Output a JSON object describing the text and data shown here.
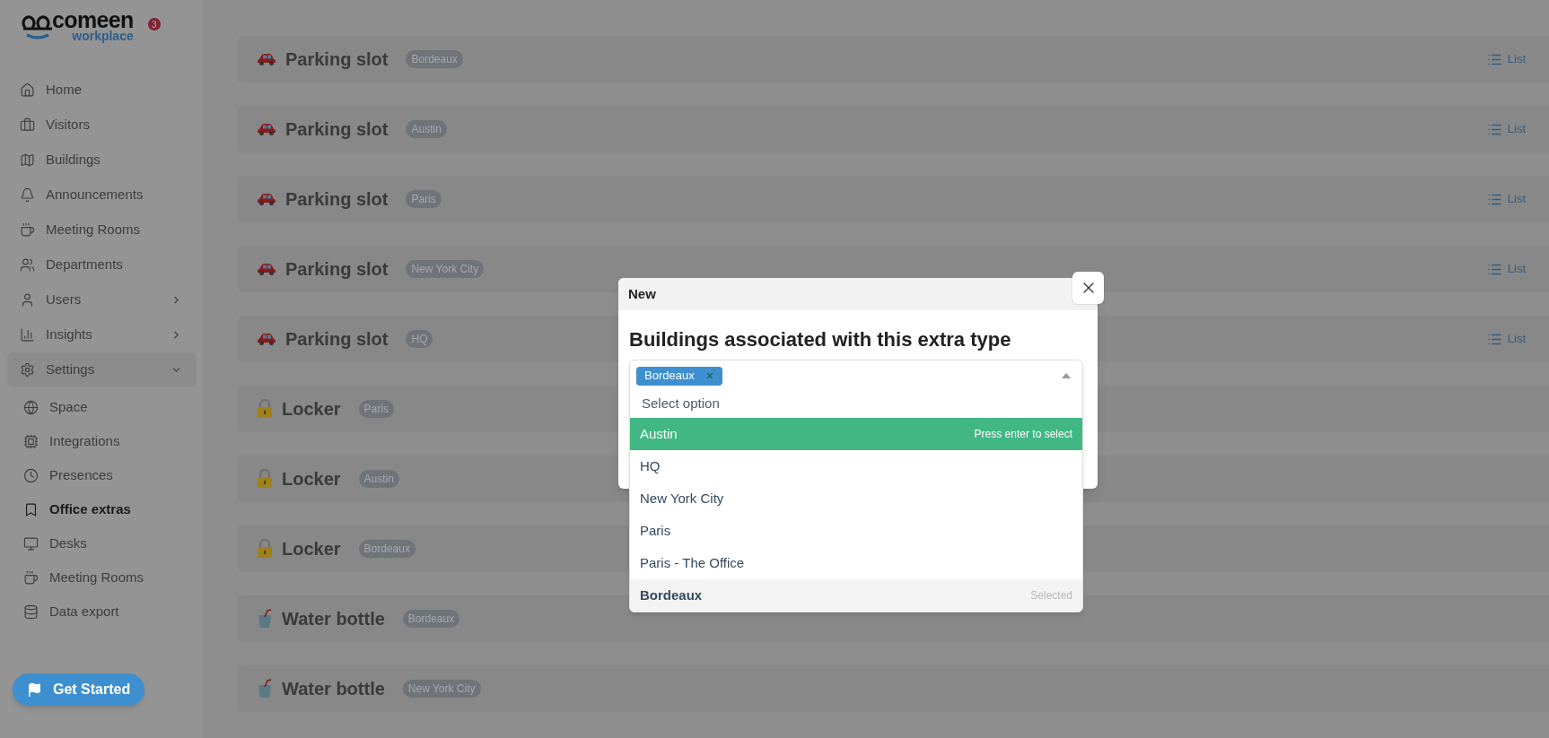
{
  "sidebar": {
    "logo": {
      "name": "comeen",
      "sub": "workplace"
    },
    "notification_count": "3",
    "items": [
      {
        "label": "Home",
        "selected": false
      },
      {
        "label": "Visitors",
        "selected": false
      },
      {
        "label": "Buildings",
        "selected": false
      },
      {
        "label": "Announcements",
        "selected": false
      },
      {
        "label": "Meeting Rooms",
        "selected": false
      },
      {
        "label": "Departments",
        "selected": false
      },
      {
        "label": "Users",
        "selected": false,
        "expanded": false
      },
      {
        "label": "Insights",
        "selected": false,
        "expanded": false
      },
      {
        "label": "Settings",
        "selected": false,
        "expanded": true,
        "children": [
          {
            "label": "Space",
            "selected": false
          },
          {
            "label": "Integrations",
            "selected": false
          },
          {
            "label": "Presences",
            "selected": false
          },
          {
            "label": "Office extras",
            "selected": true
          },
          {
            "label": "Desks",
            "selected": false
          },
          {
            "label": "Meeting Rooms",
            "selected": false
          },
          {
            "label": "Data export",
            "selected": false
          }
        ]
      }
    ],
    "get_started": "Get Started"
  },
  "extras": [
    {
      "kind": "car",
      "name": "Parking slot",
      "building": "Bordeaux",
      "link": "List"
    },
    {
      "kind": "car",
      "name": "Parking slot",
      "building": "Austin",
      "link": "List"
    },
    {
      "kind": "car",
      "name": "Parking slot",
      "building": "Paris",
      "link": "List"
    },
    {
      "kind": "car",
      "name": "Parking slot",
      "building": "New York City",
      "link": "List"
    },
    {
      "kind": "car",
      "name": "Parking slot",
      "building": "HQ",
      "link": "List"
    },
    {
      "kind": "lock",
      "name": "Locker",
      "building": "Paris"
    },
    {
      "kind": "lock",
      "name": "Locker",
      "building": "Austin"
    },
    {
      "kind": "lock",
      "name": "Locker",
      "building": "Bordeaux"
    },
    {
      "kind": "cup",
      "name": "Water bottle",
      "building": "Bordeaux"
    },
    {
      "kind": "cup",
      "name": "Water bottle",
      "building": "New York City"
    }
  ],
  "modal": {
    "title": "New",
    "heading": "Buildings associated with this extra type",
    "select": {
      "open": true,
      "tags": [
        {
          "label": "Bordeaux"
        }
      ],
      "placeholder": "Select option",
      "options": [
        {
          "label": "Austin",
          "highlighted": true,
          "selected": false,
          "hint": "Press enter to select"
        },
        {
          "label": "HQ",
          "highlighted": false,
          "selected": false
        },
        {
          "label": "New York City",
          "highlighted": false,
          "selected": false
        },
        {
          "label": "Paris",
          "highlighted": false,
          "selected": false
        },
        {
          "label": "Paris - The Office",
          "highlighted": false,
          "selected": false
        },
        {
          "label": "Bordeaux",
          "highlighted": false,
          "selected": true,
          "hint": "Selected"
        }
      ]
    }
  }
}
